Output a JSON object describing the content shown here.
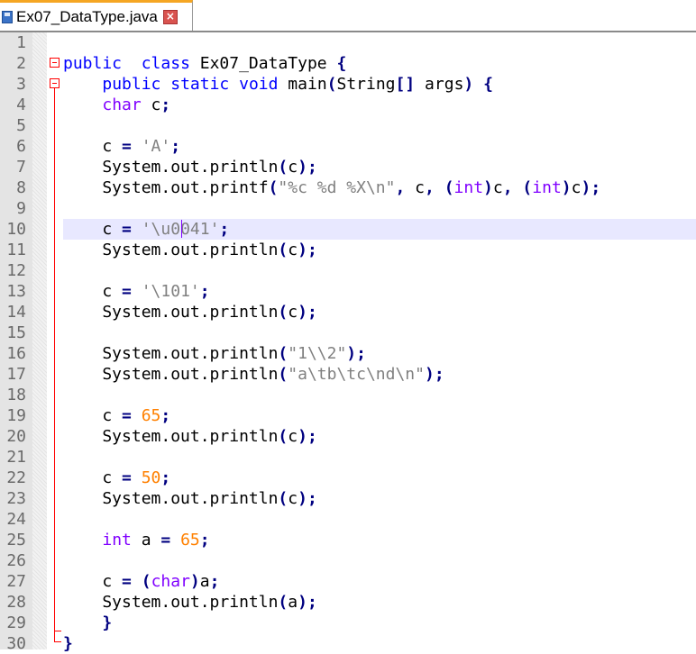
{
  "tab": {
    "filename": "Ex07_DataType.java",
    "icon": "save-icon",
    "close_icon": "close-icon"
  },
  "colors": {
    "keyword": "#0000ff",
    "type": "#8000ff",
    "string": "#808080",
    "number": "#ff8000",
    "operator": "#000080",
    "current_line": "#e8e8ff",
    "fold_marker": "#ff0000",
    "tab_accent": "#f5a623"
  },
  "editor": {
    "current_line": 10,
    "lines": [
      {
        "n": "1",
        "tokens": []
      },
      {
        "n": "2",
        "tokens": [
          [
            "kw",
            "public"
          ],
          [
            "",
            "  "
          ],
          [
            "kw",
            "class"
          ],
          [
            "",
            " Ex07_DataType "
          ],
          [
            "op",
            "{"
          ]
        ]
      },
      {
        "n": "3",
        "tokens": [
          [
            "",
            "    "
          ],
          [
            "kw",
            "public"
          ],
          [
            "",
            " "
          ],
          [
            "kw",
            "static"
          ],
          [
            "",
            " "
          ],
          [
            "kw",
            "void"
          ],
          [
            "",
            " main"
          ],
          [
            "op",
            "("
          ],
          [
            "",
            "String"
          ],
          [
            "op",
            "[]"
          ],
          [
            "",
            " args"
          ],
          [
            "op",
            ")"
          ],
          [
            "",
            " "
          ],
          [
            "op",
            "{"
          ]
        ]
      },
      {
        "n": "4",
        "tokens": [
          [
            "",
            "    "
          ],
          [
            "typ",
            "char"
          ],
          [
            "",
            " c"
          ],
          [
            "op",
            ";"
          ]
        ]
      },
      {
        "n": "5",
        "tokens": []
      },
      {
        "n": "6",
        "tokens": [
          [
            "",
            "    c "
          ],
          [
            "op",
            "="
          ],
          [
            "",
            " "
          ],
          [
            "str",
            "'A'"
          ],
          [
            "op",
            ";"
          ]
        ]
      },
      {
        "n": "7",
        "tokens": [
          [
            "",
            "    System.out.println"
          ],
          [
            "op",
            "("
          ],
          [
            "",
            "c"
          ],
          [
            "op",
            ")"
          ],
          [
            "op",
            ";"
          ]
        ]
      },
      {
        "n": "8",
        "tokens": [
          [
            "",
            "    System.out.printf"
          ],
          [
            "op",
            "("
          ],
          [
            "str",
            "\"%c %d %X\\n\""
          ],
          [
            "op",
            ","
          ],
          [
            "",
            " c"
          ],
          [
            "op",
            ","
          ],
          [
            "",
            " "
          ],
          [
            "op",
            "("
          ],
          [
            "typ",
            "int"
          ],
          [
            "op",
            ")"
          ],
          [
            "",
            "c"
          ],
          [
            "op",
            ","
          ],
          [
            "",
            " "
          ],
          [
            "op",
            "("
          ],
          [
            "typ",
            "int"
          ],
          [
            "op",
            ")"
          ],
          [
            "",
            "c"
          ],
          [
            "op",
            ")"
          ],
          [
            "op",
            ";"
          ]
        ]
      },
      {
        "n": "9",
        "tokens": []
      },
      {
        "n": "10",
        "tokens": [
          [
            "",
            "    c "
          ],
          [
            "op",
            "="
          ],
          [
            "",
            " "
          ],
          [
            "str",
            "'\\u0041'"
          ],
          [
            "op",
            ";"
          ]
        ]
      },
      {
        "n": "11",
        "tokens": [
          [
            "",
            "    System.out.println"
          ],
          [
            "op",
            "("
          ],
          [
            "",
            "c"
          ],
          [
            "op",
            ")"
          ],
          [
            "op",
            ";"
          ]
        ]
      },
      {
        "n": "12",
        "tokens": []
      },
      {
        "n": "13",
        "tokens": [
          [
            "",
            "    c "
          ],
          [
            "op",
            "="
          ],
          [
            "",
            " "
          ],
          [
            "str",
            "'\\101'"
          ],
          [
            "op",
            ";"
          ]
        ]
      },
      {
        "n": "14",
        "tokens": [
          [
            "",
            "    System.out.println"
          ],
          [
            "op",
            "("
          ],
          [
            "",
            "c"
          ],
          [
            "op",
            ")"
          ],
          [
            "op",
            ";"
          ]
        ]
      },
      {
        "n": "15",
        "tokens": []
      },
      {
        "n": "16",
        "tokens": [
          [
            "",
            "    System.out.println"
          ],
          [
            "op",
            "("
          ],
          [
            "str",
            "\"1\\\\2\""
          ],
          [
            "op",
            ")"
          ],
          [
            "op",
            ";"
          ]
        ]
      },
      {
        "n": "17",
        "tokens": [
          [
            "",
            "    System.out.println"
          ],
          [
            "op",
            "("
          ],
          [
            "str",
            "\"a\\tb\\tc\\nd\\n\""
          ],
          [
            "op",
            ")"
          ],
          [
            "op",
            ";"
          ]
        ]
      },
      {
        "n": "18",
        "tokens": []
      },
      {
        "n": "19",
        "tokens": [
          [
            "",
            "    c "
          ],
          [
            "op",
            "="
          ],
          [
            "",
            " "
          ],
          [
            "num",
            "65"
          ],
          [
            "op",
            ";"
          ]
        ]
      },
      {
        "n": "20",
        "tokens": [
          [
            "",
            "    System.out.println"
          ],
          [
            "op",
            "("
          ],
          [
            "",
            "c"
          ],
          [
            "op",
            ")"
          ],
          [
            "op",
            ";"
          ]
        ]
      },
      {
        "n": "21",
        "tokens": []
      },
      {
        "n": "22",
        "tokens": [
          [
            "",
            "    c "
          ],
          [
            "op",
            "="
          ],
          [
            "",
            " "
          ],
          [
            "num",
            "50"
          ],
          [
            "op",
            ";"
          ]
        ]
      },
      {
        "n": "23",
        "tokens": [
          [
            "",
            "    System.out.println"
          ],
          [
            "op",
            "("
          ],
          [
            "",
            "c"
          ],
          [
            "op",
            ")"
          ],
          [
            "op",
            ";"
          ]
        ]
      },
      {
        "n": "24",
        "tokens": []
      },
      {
        "n": "25",
        "tokens": [
          [
            "",
            "    "
          ],
          [
            "typ",
            "int"
          ],
          [
            "",
            " a "
          ],
          [
            "op",
            "="
          ],
          [
            "",
            " "
          ],
          [
            "num",
            "65"
          ],
          [
            "op",
            ";"
          ]
        ]
      },
      {
        "n": "26",
        "tokens": []
      },
      {
        "n": "27",
        "tokens": [
          [
            "",
            "    c "
          ],
          [
            "op",
            "="
          ],
          [
            "",
            " "
          ],
          [
            "op",
            "("
          ],
          [
            "typ",
            "char"
          ],
          [
            "op",
            ")"
          ],
          [
            "",
            "a"
          ],
          [
            "op",
            ";"
          ]
        ]
      },
      {
        "n": "28",
        "tokens": [
          [
            "",
            "    System.out.println"
          ],
          [
            "op",
            "("
          ],
          [
            "",
            "a"
          ],
          [
            "op",
            ")"
          ],
          [
            "op",
            ";"
          ]
        ]
      },
      {
        "n": "29",
        "tokens": [
          [
            "",
            "    "
          ],
          [
            "op",
            "}"
          ]
        ]
      },
      {
        "n": "30",
        "tokens": [
          [
            "op",
            "}"
          ]
        ]
      }
    ]
  }
}
